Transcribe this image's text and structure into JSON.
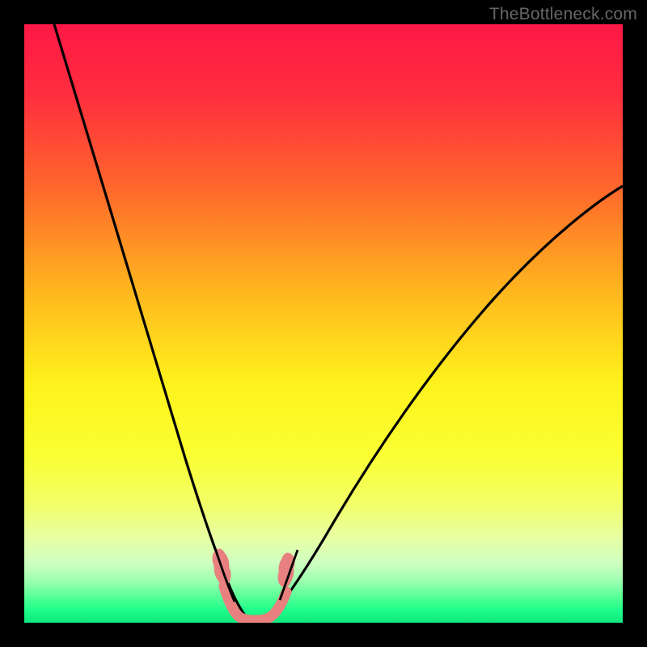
{
  "watermark": {
    "text": "TheBottleneck.com"
  },
  "chart_data": {
    "type": "line",
    "title": "",
    "xlabel": "",
    "ylabel": "",
    "xlim": [
      0,
      100
    ],
    "ylim": [
      0,
      100
    ],
    "grid": false,
    "legend": false,
    "background_gradient": {
      "direction": "vertical",
      "stops": [
        {
          "pos": 0.0,
          "color": "#ff1846"
        },
        {
          "pos": 0.12,
          "color": "#ff2e3e"
        },
        {
          "pos": 0.28,
          "color": "#ff6a2b"
        },
        {
          "pos": 0.45,
          "color": "#ffb81e"
        },
        {
          "pos": 0.6,
          "color": "#fff21c"
        },
        {
          "pos": 0.72,
          "color": "#faff33"
        },
        {
          "pos": 0.8,
          "color": "#f2ff66"
        },
        {
          "pos": 0.86,
          "color": "#e7ffa6"
        },
        {
          "pos": 0.9,
          "color": "#cfffc0"
        },
        {
          "pos": 0.93,
          "color": "#9dffb0"
        },
        {
          "pos": 0.96,
          "color": "#4dff94"
        },
        {
          "pos": 0.98,
          "color": "#1cfd8a"
        },
        {
          "pos": 1.0,
          "color": "#12e67e"
        }
      ]
    },
    "series": [
      {
        "name": "left-curve",
        "x": [
          5,
          8,
          11,
          14,
          17,
          20,
          23,
          26,
          28,
          30,
          31.5,
          33,
          34.5,
          36,
          37
        ],
        "y": [
          100,
          90,
          80,
          70,
          60,
          50,
          40,
          30,
          22,
          15,
          10,
          6,
          3,
          1.2,
          0.5
        ]
      },
      {
        "name": "right-curve",
        "x": [
          41,
          43,
          45,
          48,
          52,
          57,
          63,
          70,
          78,
          86,
          94,
          100
        ],
        "y": [
          0.5,
          1.5,
          3.5,
          7,
          12,
          19,
          27,
          36,
          46,
          56,
          65,
          72
        ]
      },
      {
        "name": "bottom-segment",
        "x": [
          33,
          35,
          37,
          39,
          41,
          43
        ],
        "y": [
          3,
          1.2,
          0.6,
          0.5,
          0.8,
          2.2
        ]
      }
    ],
    "annotations": {
      "marker_color": "#e88080",
      "left_marker_x": 33,
      "right_marker_x": 43,
      "bottom_y": 0.5
    }
  }
}
